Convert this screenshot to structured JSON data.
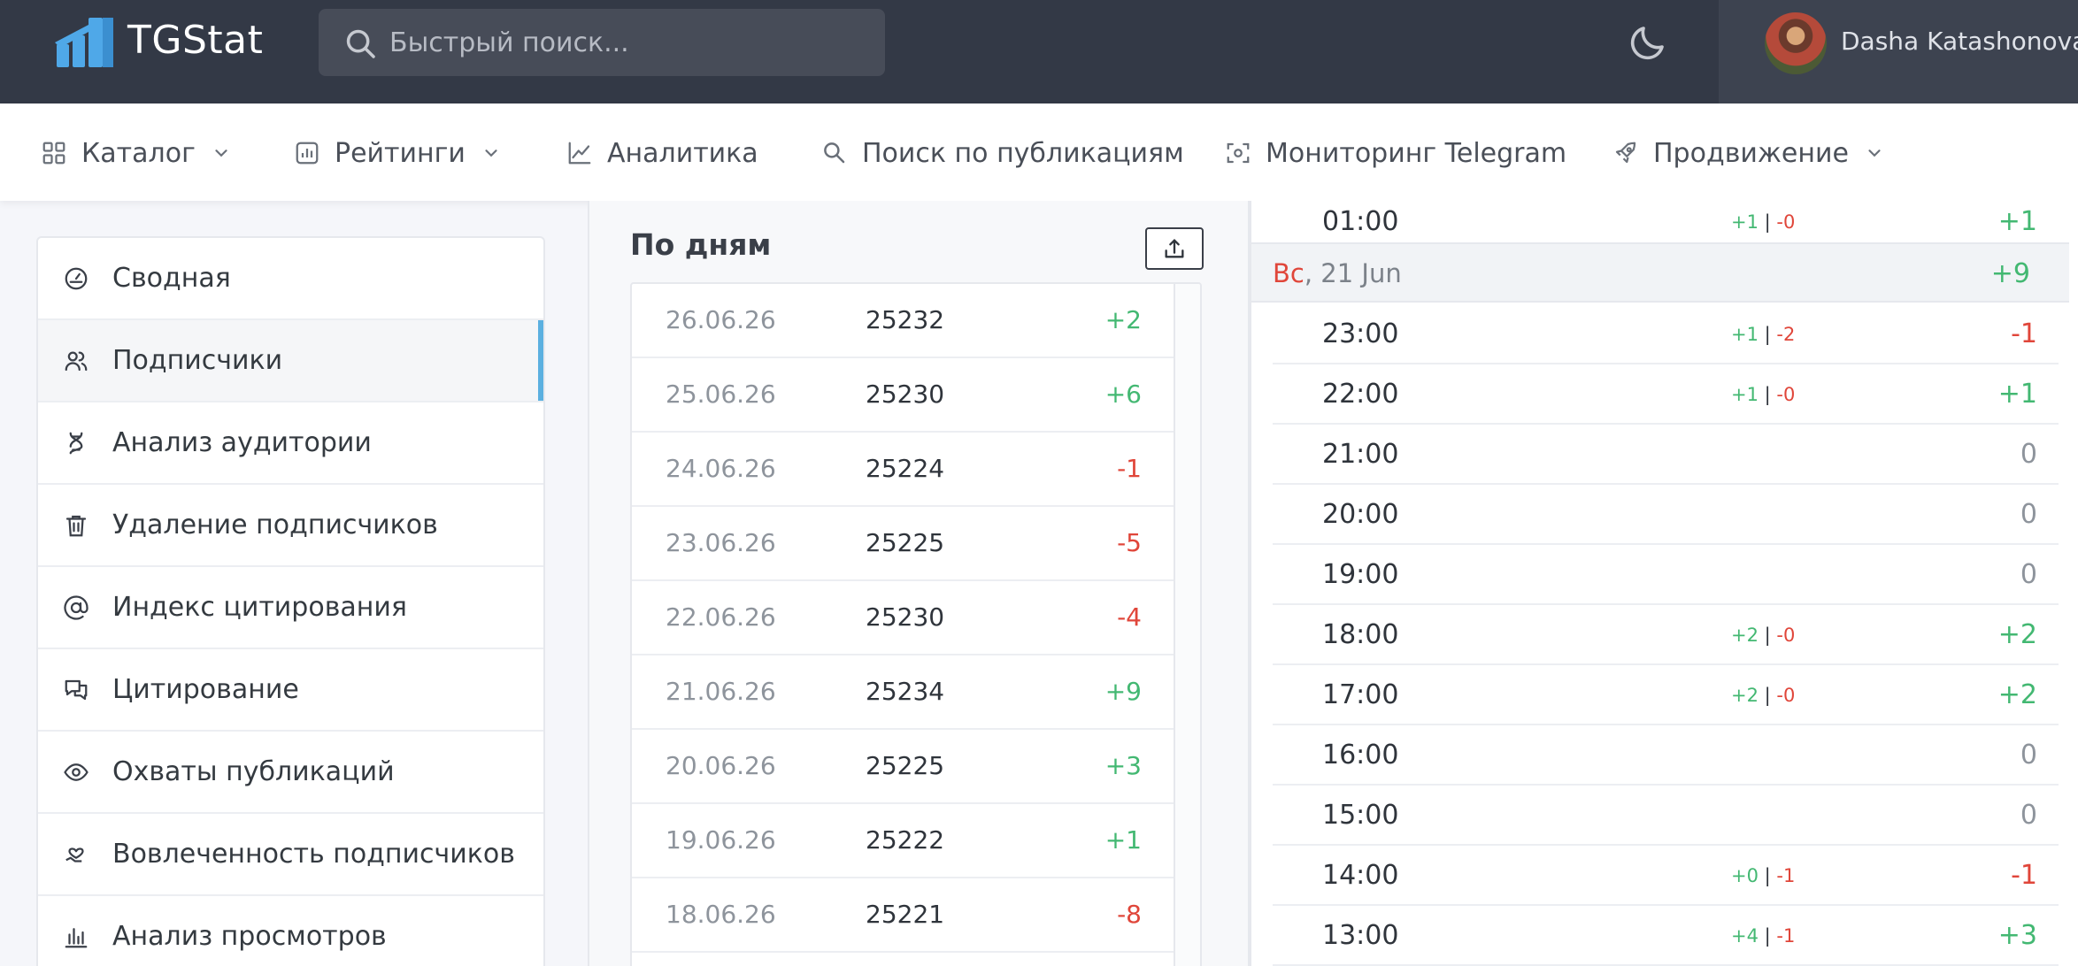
{
  "app": {
    "brand": "TGStat"
  },
  "search": {
    "placeholder": "Быстрый поиск..."
  },
  "user": {
    "name": "Dasha Katashonova"
  },
  "nav": [
    {
      "label": "Каталог",
      "icon": "grid-icon",
      "dropdown": true
    },
    {
      "label": "Рейтинги",
      "icon": "bar-chart-icon",
      "dropdown": true
    },
    {
      "label": "Аналитика",
      "icon": "line-chart-icon",
      "dropdown": false
    },
    {
      "label": "Поиск по публикациям",
      "icon": "search-icon",
      "dropdown": false
    },
    {
      "label": "Мониторинг Telegram",
      "icon": "scan-icon",
      "dropdown": false
    },
    {
      "label": "Продвижение",
      "icon": "rocket-icon",
      "dropdown": true
    }
  ],
  "sidebar": {
    "items": [
      {
        "label": "Сводная",
        "icon": "dashboard-icon"
      },
      {
        "label": "Подписчики",
        "icon": "users-icon",
        "active": true
      },
      {
        "label": "Анализ аудитории",
        "icon": "dna-icon"
      },
      {
        "label": "Удаление подписчиков",
        "icon": "trash-icon"
      },
      {
        "label": "Индекс цитирования",
        "icon": "at-icon"
      },
      {
        "label": "Цитирование",
        "icon": "chat-icon"
      },
      {
        "label": "Охваты публикаций",
        "icon": "eye-icon"
      },
      {
        "label": "Вовлеченность подписчиков",
        "icon": "heart-hand-icon"
      },
      {
        "label": "Анализ просмотров",
        "icon": "views-chart-icon"
      }
    ]
  },
  "days": {
    "title": "По дням",
    "rows": [
      {
        "date": "26.06.26",
        "count": "25232",
        "delta": "+2",
        "sign": "pos"
      },
      {
        "date": "25.06.26",
        "count": "25230",
        "delta": "+6",
        "sign": "pos"
      },
      {
        "date": "24.06.26",
        "count": "25224",
        "delta": "-1",
        "sign": "neg"
      },
      {
        "date": "23.06.26",
        "count": "25225",
        "delta": "-5",
        "sign": "neg"
      },
      {
        "date": "22.06.26",
        "count": "25230",
        "delta": "-4",
        "sign": "neg"
      },
      {
        "date": "21.06.26",
        "count": "25234",
        "delta": "+9",
        "sign": "pos"
      },
      {
        "date": "20.06.26",
        "count": "25225",
        "delta": "+3",
        "sign": "pos"
      },
      {
        "date": "19.06.26",
        "count": "25222",
        "delta": "+1",
        "sign": "pos"
      },
      {
        "date": "18.06.26",
        "count": "25221",
        "delta": "-8",
        "sign": "neg"
      }
    ]
  },
  "hours": {
    "top_row": {
      "time": "01:00",
      "plus": "+1",
      "minus": "-0",
      "delta": "+1",
      "sign": "pos"
    },
    "day_header": {
      "weekday": "Вс",
      "date": ", 21 Jun",
      "delta": "+9",
      "sign": "pos"
    },
    "rows": [
      {
        "time": "23:00",
        "plus": "+1",
        "minus": "-2",
        "delta": "-1",
        "sign": "neg"
      },
      {
        "time": "22:00",
        "plus": "+1",
        "minus": "-0",
        "delta": "+1",
        "sign": "pos"
      },
      {
        "time": "21:00",
        "plus": "",
        "minus": "",
        "delta": "0",
        "sign": "zero"
      },
      {
        "time": "20:00",
        "plus": "",
        "minus": "",
        "delta": "0",
        "sign": "zero"
      },
      {
        "time": "19:00",
        "plus": "",
        "minus": "",
        "delta": "0",
        "sign": "zero"
      },
      {
        "time": "18:00",
        "plus": "+2",
        "minus": "-0",
        "delta": "+2",
        "sign": "pos"
      },
      {
        "time": "17:00",
        "plus": "+2",
        "minus": "-0",
        "delta": "+2",
        "sign": "pos"
      },
      {
        "time": "16:00",
        "plus": "",
        "minus": "",
        "delta": "0",
        "sign": "zero"
      },
      {
        "time": "15:00",
        "plus": "",
        "minus": "",
        "delta": "0",
        "sign": "zero"
      },
      {
        "time": "14:00",
        "plus": "+0",
        "minus": "-1",
        "delta": "-1",
        "sign": "neg"
      },
      {
        "time": "13:00",
        "plus": "+4",
        "minus": "-1",
        "delta": "+3",
        "sign": "pos"
      }
    ]
  },
  "colors": {
    "positive": "#43b872",
    "negative": "#e0463a",
    "accent": "#5bb0e0",
    "header": "#333946"
  }
}
